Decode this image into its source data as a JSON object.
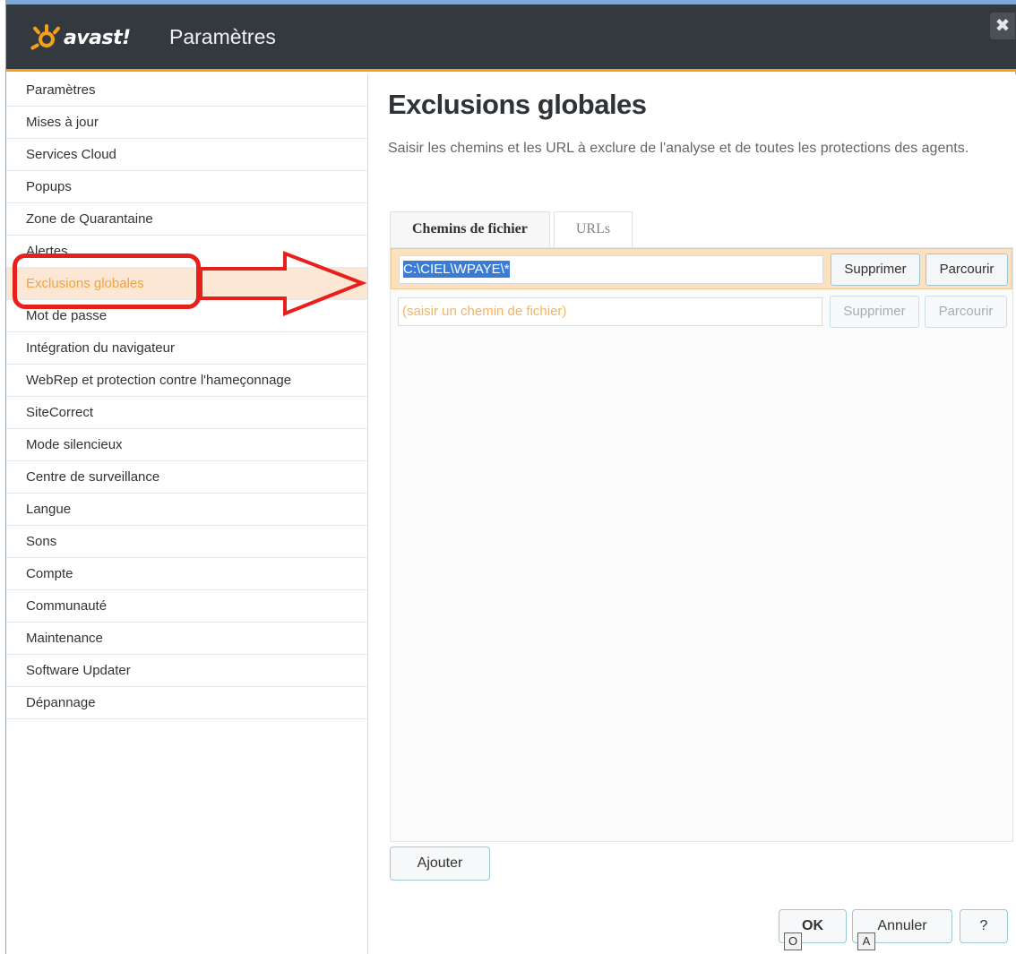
{
  "window": {
    "brand": "avast!",
    "title": "Paramètres",
    "close_glyph": "✖"
  },
  "sidebar": {
    "items": [
      {
        "label": "Paramètres"
      },
      {
        "label": "Mises à jour"
      },
      {
        "label": "Services Cloud"
      },
      {
        "label": "Popups"
      },
      {
        "label": "Zone de Quarantaine"
      },
      {
        "label": "Alertes"
      },
      {
        "label": "Exclusions globales",
        "active": true
      },
      {
        "label": "Mot de passe"
      },
      {
        "label": "Intégration du navigateur"
      },
      {
        "label": "WebRep et protection contre l'hameçonnage"
      },
      {
        "label": "SiteCorrect"
      },
      {
        "label": "Mode silencieux"
      },
      {
        "label": "Centre de surveillance"
      },
      {
        "label": "Langue"
      },
      {
        "label": "Sons"
      },
      {
        "label": "Compte"
      },
      {
        "label": "Communauté"
      },
      {
        "label": "Maintenance"
      },
      {
        "label": "Software Updater"
      },
      {
        "label": "Dépannage"
      }
    ]
  },
  "main": {
    "title": "Exclusions globales",
    "description": "Saisir les chemins et les URL à exclure de l'analyse et de toutes les protections des agents.",
    "tabs": [
      {
        "label": "Chemins de fichier",
        "active": true
      },
      {
        "label": "URLs",
        "active": false
      }
    ],
    "rows": [
      {
        "value": "C:\\CIEL\\WPAYE\\*",
        "delete_label": "Supprimer",
        "browse_label": "Parcourir",
        "selected": true
      },
      {
        "placeholder": "(saisir un chemin de fichier)",
        "delete_label": "Supprimer",
        "browse_label": "Parcourir",
        "disabled": true
      }
    ],
    "add_label": "Ajouter"
  },
  "footer": {
    "ok_label": "OK",
    "cancel_label": "Annuler",
    "help_label": "?",
    "ok_hotkey": "O",
    "cancel_hotkey": "A"
  },
  "colors": {
    "titlebar": "#33393e",
    "accent": "#f5a01a",
    "active_item_text": "#f0a340",
    "annotation": "#e8201c"
  }
}
